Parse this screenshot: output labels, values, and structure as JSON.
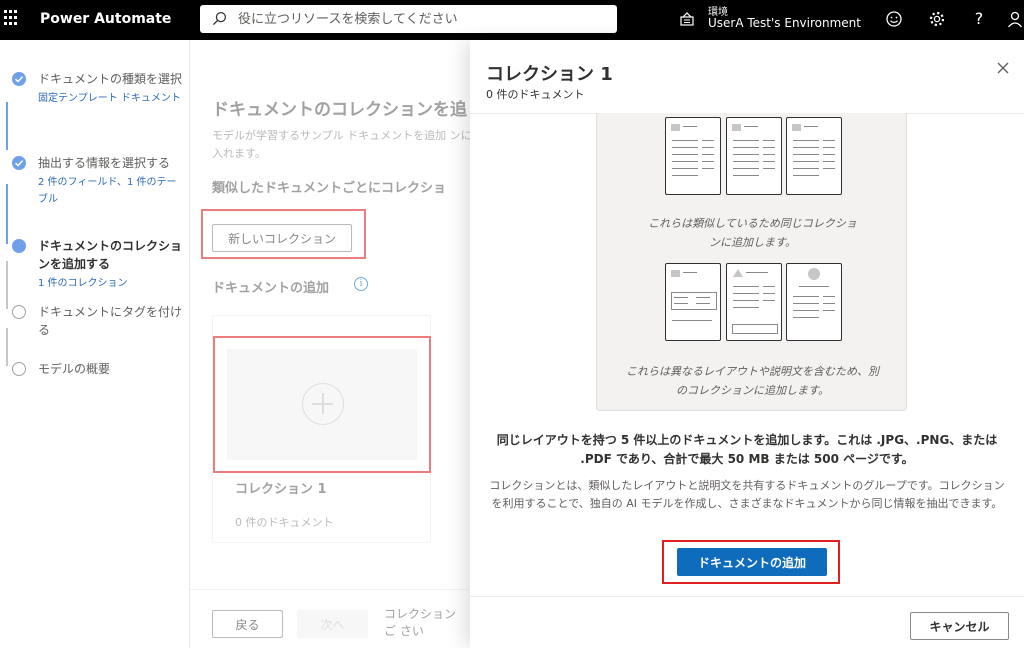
{
  "topbar": {
    "app_title": "Power Automate",
    "search_placeholder": "役に立つリソースを検索してください",
    "env_label": "環境",
    "env_name": "UserA Test's Environment",
    "icons": [
      "waffle-icon",
      "search-icon",
      "environment-icon",
      "smiley-icon",
      "gear-icon",
      "help-icon",
      "person-icon"
    ]
  },
  "stepper": {
    "steps": [
      {
        "title": "ドキュメントの種類を選択",
        "sub": "固定テンプレート ドキュメント",
        "state": "done"
      },
      {
        "title": "抽出する情報を選択する",
        "sub": "2 件のフィールド、1 件のテーブル",
        "state": "done"
      },
      {
        "title": "ドキュメントのコレクションを追加する",
        "sub": "1 件のコレクション",
        "state": "current"
      },
      {
        "title": "ドキュメントにタグを付ける",
        "sub": "",
        "state": "todo"
      },
      {
        "title": "モデルの概要",
        "sub": "",
        "state": "todo"
      }
    ]
  },
  "main": {
    "heading": "ドキュメントのコレクションを追",
    "description": "モデルが学習するサンプル ドキュメントを追加 ンに入れます。",
    "subheading": "類似したドキュメントごとにコレクショ",
    "new_collection_label": "新しいコレクション",
    "add_docs_heading": "ドキュメントの追加",
    "card": {
      "name": "コレクション 1",
      "count": "0 件のドキュメント"
    },
    "footer": {
      "back_label": "戻る",
      "next_label": "次へ",
      "note": "コレクションご さい"
    }
  },
  "panel": {
    "title": "コレクション 1",
    "subtitle": "0 件のドキュメント",
    "caption_similar": "これらは類似しているため同じコレクションに追加します。",
    "caption_different": "これらは異なるレイアウトや説明文を含むため、別のコレクションに追加します。",
    "bold_text": "同じレイアウトを持つ 5 件以上のドキュメントを追加します。これは .JPG、.PNG、または .PDF であり、合計で最大 50 MB または 500 ページです。",
    "description": "コレクションとは、類似したレイアウトと説明文を共有するドキュメントのグループです。コレクションを利用することで、独自の AI モデルを作成し、さまざまなドキュメントから同じ情報を抽出できます。",
    "add_button_label": "ドキュメントの追加",
    "cancel_label": "キャンセル"
  },
  "colors": {
    "accent": "#0f6cbd",
    "highlight": "#e02020",
    "step_active": "#70a0e8",
    "topbar": "#000000"
  }
}
